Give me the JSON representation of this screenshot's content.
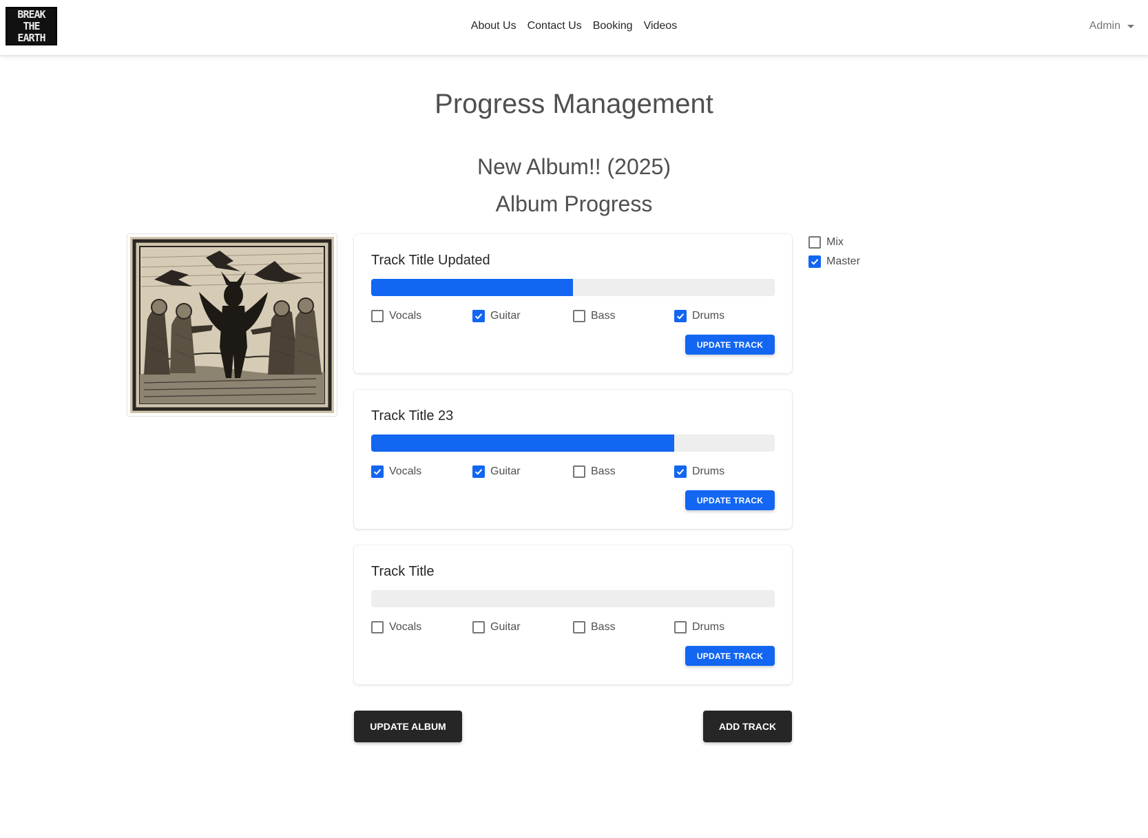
{
  "navbar": {
    "logo_text": "BREAK THE EARTH",
    "links": [
      "About Us",
      "Contact Us",
      "Booking",
      "Videos"
    ],
    "admin_label": "Admin"
  },
  "page": {
    "title": "Progress Management",
    "album_name": "New Album!! (2025)",
    "section_title": "Album Progress"
  },
  "colors": {
    "accent": "#1266f1",
    "dark": "#262626"
  },
  "tracks": [
    {
      "title": "Track Title Updated",
      "progress_fraction": 0.5,
      "parts": [
        {
          "label": "Vocals",
          "checked": false
        },
        {
          "label": "Guitar",
          "checked": true
        },
        {
          "label": "Bass",
          "checked": false
        },
        {
          "label": "Drums",
          "checked": true
        }
      ],
      "button_label": "UPDATE TRACK"
    },
    {
      "title": "Track Title 23",
      "progress_fraction": 0.75,
      "parts": [
        {
          "label": "Vocals",
          "checked": true
        },
        {
          "label": "Guitar",
          "checked": true
        },
        {
          "label": "Bass",
          "checked": false
        },
        {
          "label": "Drums",
          "checked": true
        }
      ],
      "button_label": "UPDATE TRACK"
    },
    {
      "title": "Track Title",
      "progress_fraction": 0,
      "parts": [
        {
          "label": "Vocals",
          "checked": false
        },
        {
          "label": "Guitar",
          "checked": false
        },
        {
          "label": "Bass",
          "checked": false
        },
        {
          "label": "Drums",
          "checked": false
        }
      ],
      "button_label": "UPDATE TRACK"
    }
  ],
  "album_stages": [
    {
      "label": "Mix",
      "checked": false
    },
    {
      "label": "Master",
      "checked": true
    }
  ],
  "actions": {
    "update_album": "UPDATE ALBUM",
    "add_track": "ADD TRACK"
  }
}
